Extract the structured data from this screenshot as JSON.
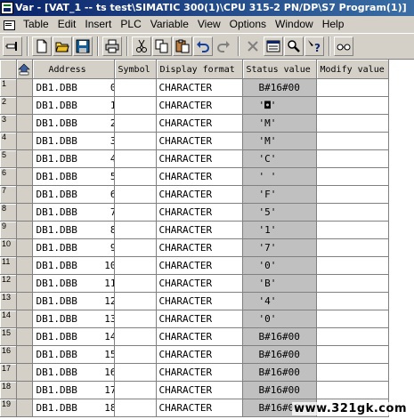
{
  "window": {
    "title": "Var - [VAT_1 -- ts test\\SIMATIC 300(1)\\CPU 315-2 PN/DP\\S7 Program(1)]"
  },
  "menu": [
    "Table",
    "Edit",
    "Insert",
    "PLC",
    "Variable",
    "View",
    "Options",
    "Window",
    "Help"
  ],
  "toolbar": {
    "buttons": [
      "pin-icon",
      "new-icon",
      "open-icon",
      "save-icon",
      "print-icon",
      "cut-icon",
      "copy-icon",
      "paste-icon",
      "undo-icon",
      "redo-icon",
      "delete-icon",
      "monitor-icon",
      "find-icon",
      "help-icon",
      "glasses-icon"
    ]
  },
  "table": {
    "columns": [
      "Address",
      "Symbol",
      "Display format",
      "Status value",
      "Modify value"
    ],
    "rows": [
      {
        "num": "1",
        "block": "DB1.DBB",
        "offset": "0",
        "symbol": "",
        "format": "CHARACTER",
        "status": "B#16#00",
        "modify": ""
      },
      {
        "num": "2",
        "block": "DB1.DBB",
        "offset": "1",
        "symbol": "",
        "format": "CHARACTER",
        "status": "'◘'",
        "modify": ""
      },
      {
        "num": "3",
        "block": "DB1.DBB",
        "offset": "2",
        "symbol": "",
        "format": "CHARACTER",
        "status": "'M'",
        "modify": ""
      },
      {
        "num": "4",
        "block": "DB1.DBB",
        "offset": "3",
        "symbol": "",
        "format": "CHARACTER",
        "status": "'M'",
        "modify": ""
      },
      {
        "num": "5",
        "block": "DB1.DBB",
        "offset": "4",
        "symbol": "",
        "format": "CHARACTER",
        "status": "'C'",
        "modify": ""
      },
      {
        "num": "6",
        "block": "DB1.DBB",
        "offset": "5",
        "symbol": "",
        "format": "CHARACTER",
        "status": "' '",
        "modify": ""
      },
      {
        "num": "7",
        "block": "DB1.DBB",
        "offset": "6",
        "symbol": "",
        "format": "CHARACTER",
        "status": "'F'",
        "modify": ""
      },
      {
        "num": "8",
        "block": "DB1.DBB",
        "offset": "7",
        "symbol": "",
        "format": "CHARACTER",
        "status": "'5'",
        "modify": ""
      },
      {
        "num": "9",
        "block": "DB1.DBB",
        "offset": "8",
        "symbol": "",
        "format": "CHARACTER",
        "status": "'1'",
        "modify": ""
      },
      {
        "num": "10",
        "block": "DB1.DBB",
        "offset": "9",
        "symbol": "",
        "format": "CHARACTER",
        "status": "'7'",
        "modify": ""
      },
      {
        "num": "11",
        "block": "DB1.DBB",
        "offset": "10",
        "symbol": "",
        "format": "CHARACTER",
        "status": "'0'",
        "modify": ""
      },
      {
        "num": "12",
        "block": "DB1.DBB",
        "offset": "11",
        "symbol": "",
        "format": "CHARACTER",
        "status": "'B'",
        "modify": ""
      },
      {
        "num": "13",
        "block": "DB1.DBB",
        "offset": "12",
        "symbol": "",
        "format": "CHARACTER",
        "status": "'4'",
        "modify": ""
      },
      {
        "num": "14",
        "block": "DB1.DBB",
        "offset": "13",
        "symbol": "",
        "format": "CHARACTER",
        "status": "'0'",
        "modify": ""
      },
      {
        "num": "15",
        "block": "DB1.DBB",
        "offset": "14",
        "symbol": "",
        "format": "CHARACTER",
        "status": "B#16#00",
        "modify": ""
      },
      {
        "num": "16",
        "block": "DB1.DBB",
        "offset": "15",
        "symbol": "",
        "format": "CHARACTER",
        "status": "B#16#00",
        "modify": ""
      },
      {
        "num": "17",
        "block": "DB1.DBB",
        "offset": "16",
        "symbol": "",
        "format": "CHARACTER",
        "status": "B#16#00",
        "modify": ""
      },
      {
        "num": "18",
        "block": "DB1.DBB",
        "offset": "17",
        "symbol": "",
        "format": "CHARACTER",
        "status": "B#16#00",
        "modify": ""
      },
      {
        "num": "19",
        "block": "DB1.DBB",
        "offset": "18",
        "symbol": "",
        "format": "CHARACTER",
        "status": "B#16#00",
        "modify": ""
      }
    ]
  },
  "watermark": "www.321gk.com",
  "colors": {
    "title_bar": "#0a246a",
    "status_column": "#c0c0c0",
    "chrome": "#d4d0c8"
  }
}
